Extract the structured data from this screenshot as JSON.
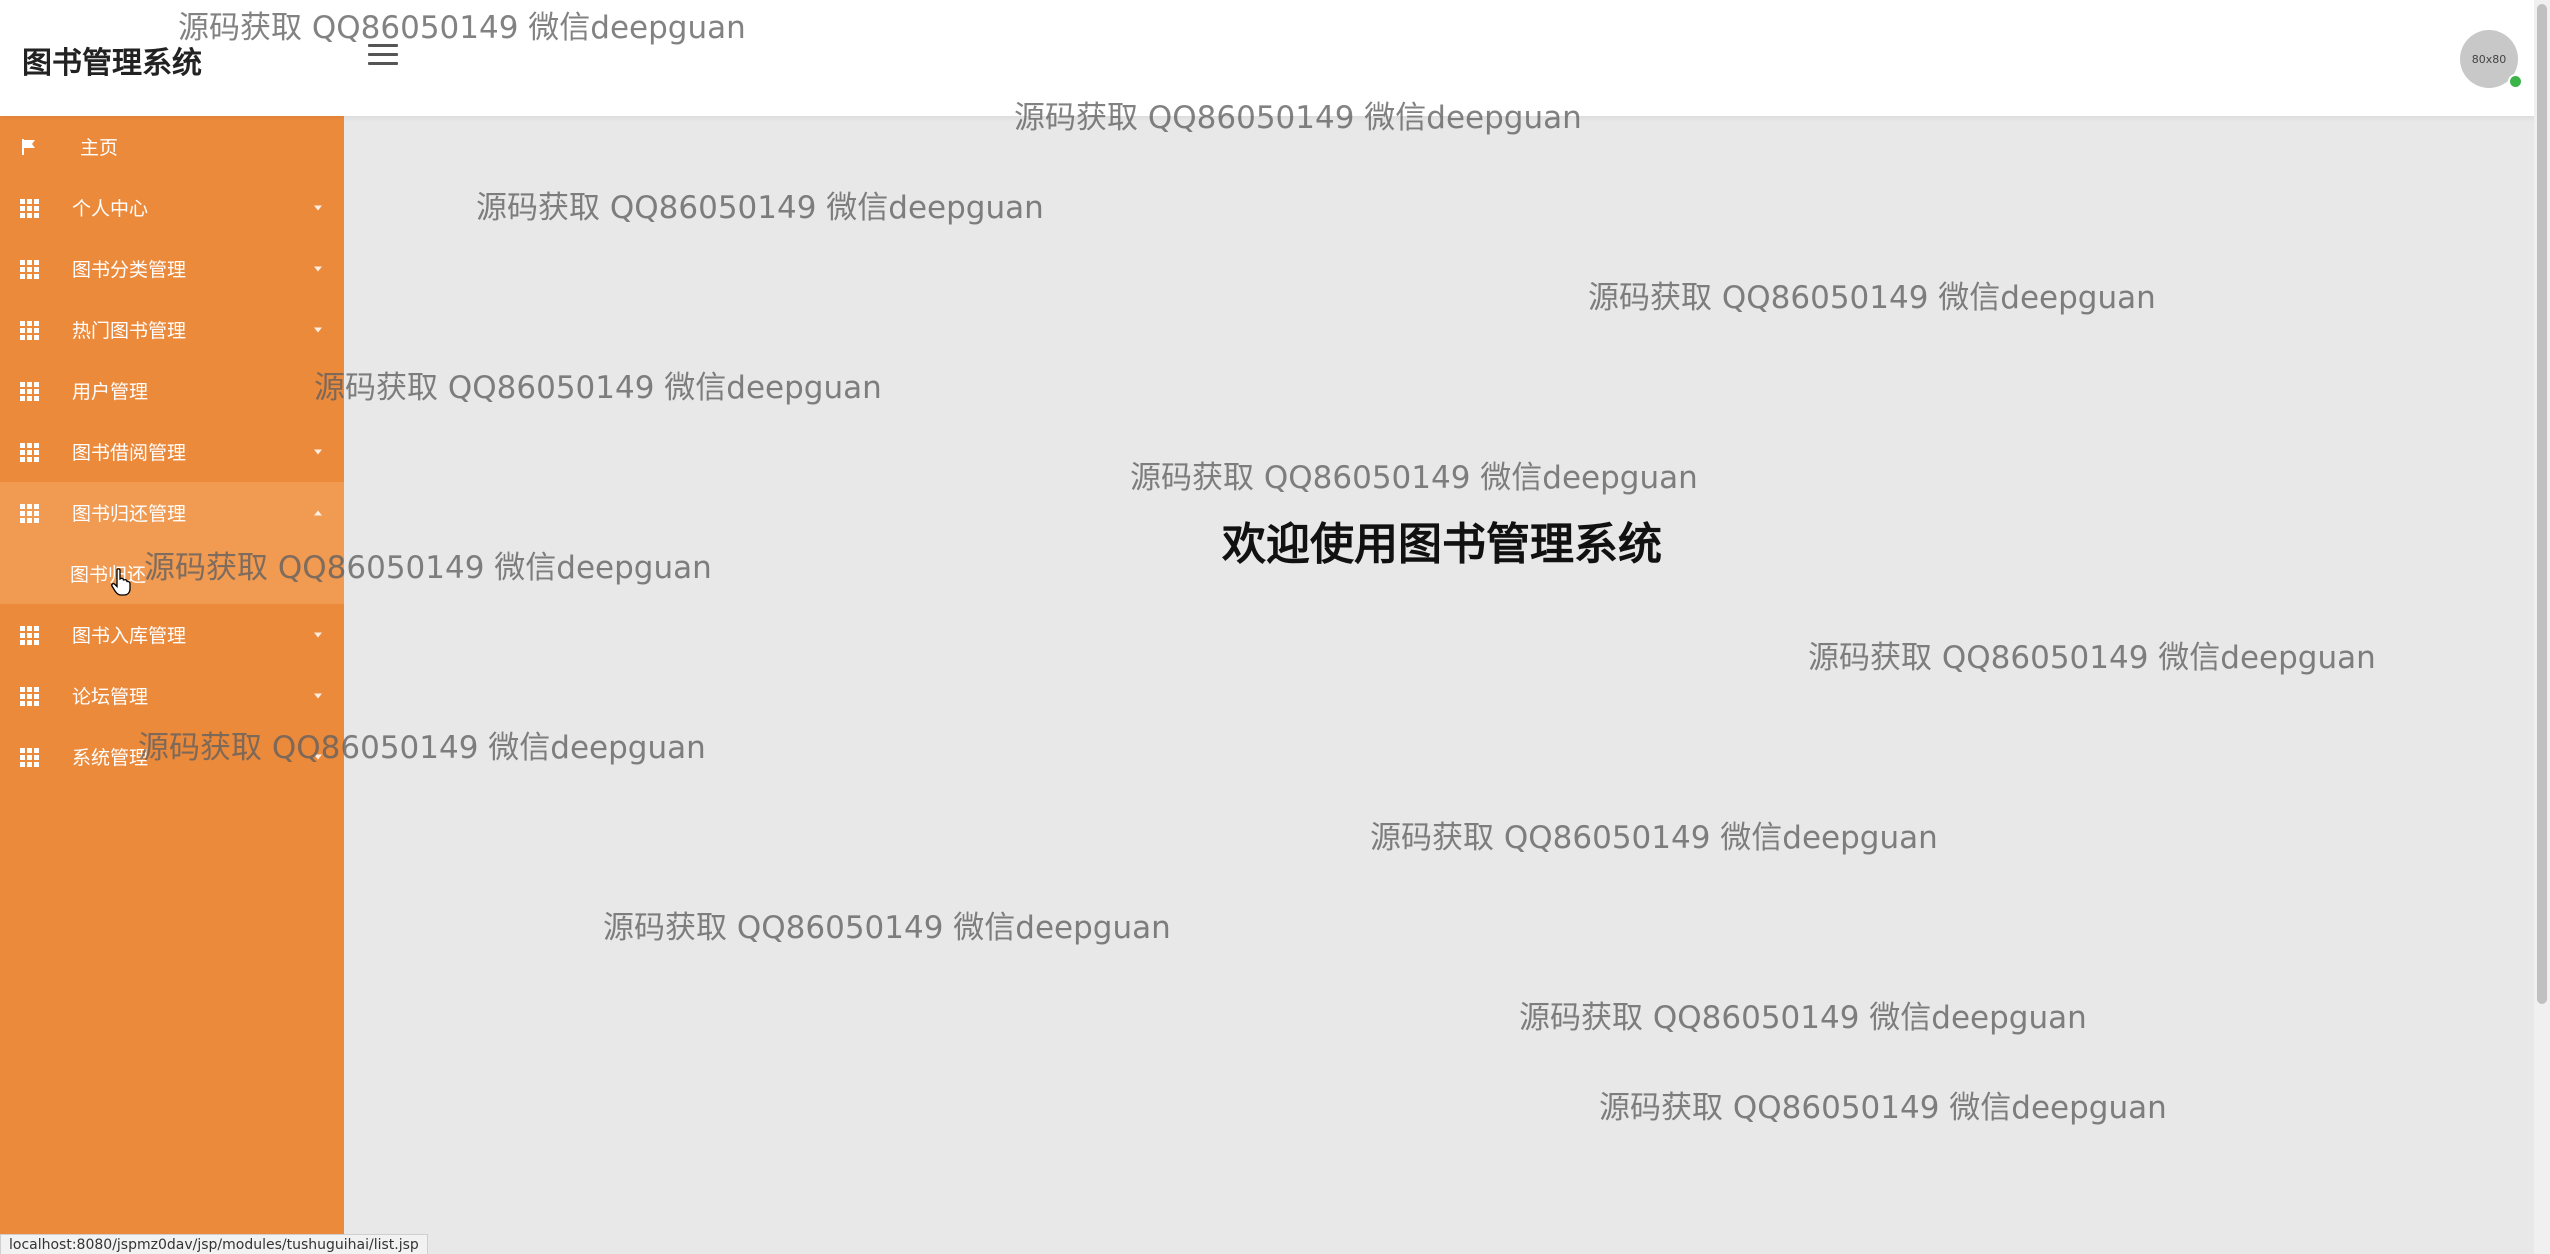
{
  "header": {
    "title": "图书管理系统",
    "avatar_text": "80x80"
  },
  "sidebar": {
    "items": [
      {
        "label": "主页",
        "icon": "flag-icon"
      },
      {
        "label": "个人中心",
        "icon": "grid-icon"
      },
      {
        "label": "图书分类管理",
        "icon": "grid-icon"
      },
      {
        "label": "热门图书管理",
        "icon": "grid-icon"
      },
      {
        "label": "用户管理",
        "icon": "grid-icon"
      },
      {
        "label": "图书借阅管理",
        "icon": "grid-icon"
      },
      {
        "label": "图书归还管理",
        "icon": "grid-icon",
        "expanded": true,
        "children": [
          {
            "label": "图书归还"
          }
        ]
      },
      {
        "label": "图书入库管理",
        "icon": "grid-icon"
      },
      {
        "label": "论坛管理",
        "icon": "grid-icon"
      },
      {
        "label": "系统管理",
        "icon": "grid-icon"
      }
    ]
  },
  "main": {
    "welcome": "欢迎使用图书管理系统"
  },
  "status_bar": {
    "url": "localhost:8080/jspmz0dav/jsp/modules/tushuguihai/list.jsp"
  },
  "watermark_text": "源码获取 QQ86050149 微信deepguan",
  "colors": {
    "sidebar": "#ec8a3c",
    "sidebar_active": "#f09a52",
    "main_bg": "#e8e8e8"
  }
}
